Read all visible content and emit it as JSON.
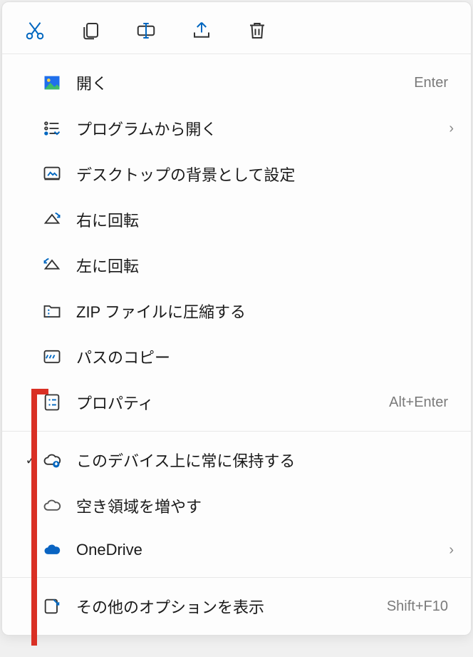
{
  "toolbar": {
    "cut": "cut",
    "copy": "copy",
    "rename": "rename",
    "share": "share",
    "delete": "delete"
  },
  "sections": [
    {
      "items": [
        {
          "icon": "image-icon",
          "label": "開く",
          "shortcut": "Enter",
          "checked": false,
          "submenu": false
        },
        {
          "icon": "open-with-icon",
          "label": "プログラムから開く",
          "shortcut": "",
          "checked": false,
          "submenu": true
        },
        {
          "icon": "wallpaper-icon",
          "label": "デスクトップの背景として設定",
          "shortcut": "",
          "checked": false,
          "submenu": false
        },
        {
          "icon": "rotate-right-icon",
          "label": "右に回転",
          "shortcut": "",
          "checked": false,
          "submenu": false
        },
        {
          "icon": "rotate-left-icon",
          "label": "左に回転",
          "shortcut": "",
          "checked": false,
          "submenu": false
        },
        {
          "icon": "zip-icon",
          "label": "ZIP ファイルに圧縮する",
          "shortcut": "",
          "checked": false,
          "submenu": false
        },
        {
          "icon": "copy-path-icon",
          "label": "パスのコピー",
          "shortcut": "",
          "checked": false,
          "submenu": false
        },
        {
          "icon": "properties-icon",
          "label": "プロパティ",
          "shortcut": "Alt+Enter",
          "checked": false,
          "submenu": false
        }
      ]
    },
    {
      "items": [
        {
          "icon": "cloud-keep-icon",
          "label": "このデバイス上に常に保持する",
          "shortcut": "",
          "checked": true,
          "submenu": false
        },
        {
          "icon": "cloud-free-icon",
          "label": "空き領域を増やす",
          "shortcut": "",
          "checked": false,
          "submenu": false
        },
        {
          "icon": "onedrive-icon",
          "label": "OneDrive",
          "shortcut": "",
          "checked": false,
          "submenu": true
        }
      ]
    },
    {
      "items": [
        {
          "icon": "more-options-icon",
          "label": "その他のオプションを表示",
          "shortcut": "Shift+F10",
          "checked": false,
          "submenu": false
        }
      ]
    }
  ]
}
